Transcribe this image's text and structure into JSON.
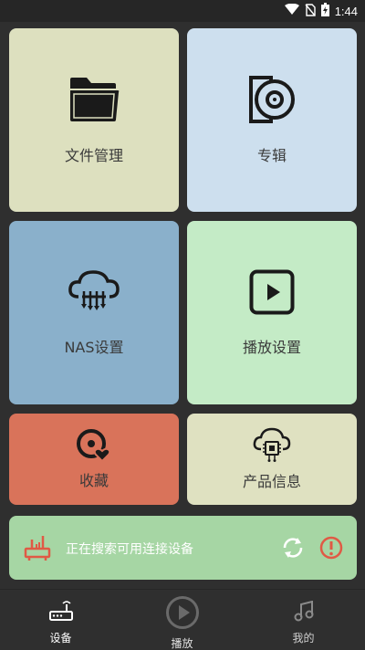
{
  "status_bar": {
    "time": "1:44",
    "icons": [
      "wifi-icon",
      "no-sim-icon",
      "battery-charging-icon"
    ]
  },
  "tiles": {
    "files": {
      "label": "文件管理",
      "icon": "folder-icon",
      "color": "#dde0bf"
    },
    "album": {
      "label": "专辑",
      "icon": "album-disc-icon",
      "color": "#cddfee"
    },
    "nas": {
      "label": "NAS设置",
      "icon": "cloud-network-icon",
      "color": "#8ab0cb"
    },
    "play_settings": {
      "label": "播放设置",
      "icon": "play-square-icon",
      "color": "#c4ebc6"
    },
    "favorites": {
      "label": "收藏",
      "icon": "disc-heart-icon",
      "color": "#d9735a"
    },
    "product_info": {
      "label": "产品信息",
      "icon": "cloud-chip-icon",
      "color": "#dfe1c1"
    }
  },
  "device_bar": {
    "status_text": "正在搜索可用连接设备",
    "icon": "router-icon",
    "refresh_icon": "refresh-icon",
    "alert_icon": "alert-icon",
    "color": "#a6d6a4",
    "accent": "#e05a45"
  },
  "tab_bar": {
    "tabs": [
      {
        "label": "设备",
        "icon": "router-icon",
        "active": true
      },
      {
        "label": "播放",
        "icon": "play-circle-icon",
        "active": false
      },
      {
        "label": "我的",
        "icon": "music-note-icon",
        "active": false
      }
    ]
  }
}
